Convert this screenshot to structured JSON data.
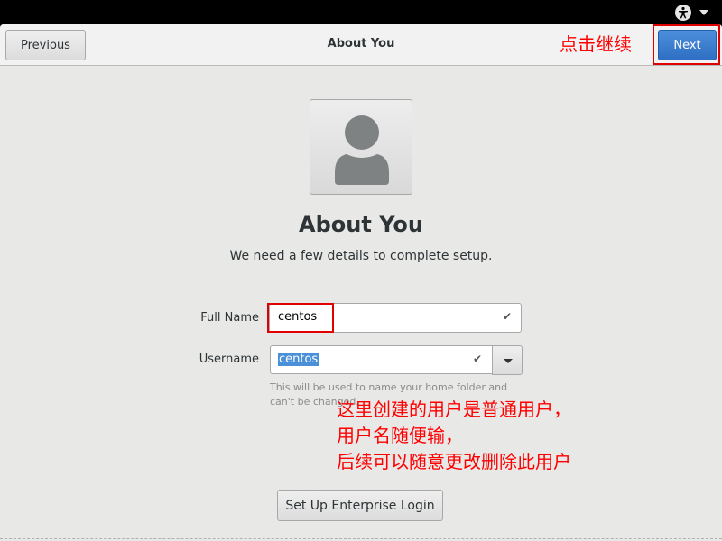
{
  "topbar": {
    "accessibility_icon": "accessibility-icon",
    "menu_icon": "caret-down-icon"
  },
  "header": {
    "previous_label": "Previous",
    "title": "About You",
    "next_label": "Next"
  },
  "main": {
    "avatar_icon": "user-avatar-icon",
    "title": "About You",
    "subtitle": "We need a few details to complete setup.",
    "full_name": {
      "label": "Full Name",
      "value": "centos"
    },
    "username": {
      "label": "Username",
      "value": "centos",
      "hint": "This will be used to name your home folder and can't be changed."
    },
    "enterprise_login_label": "Set Up Enterprise Login"
  },
  "annotations": {
    "next_note": "点击继续",
    "user_note_lines": [
      "这里创建的用户是普通用户，",
      "用户名随便输，",
      "后续可以随意更改删除此用户"
    ],
    "color": "#ff0000"
  },
  "colors": {
    "accent": "#3a7bd5",
    "selection": "#4a90d9",
    "background": "#e8e8e7"
  }
}
